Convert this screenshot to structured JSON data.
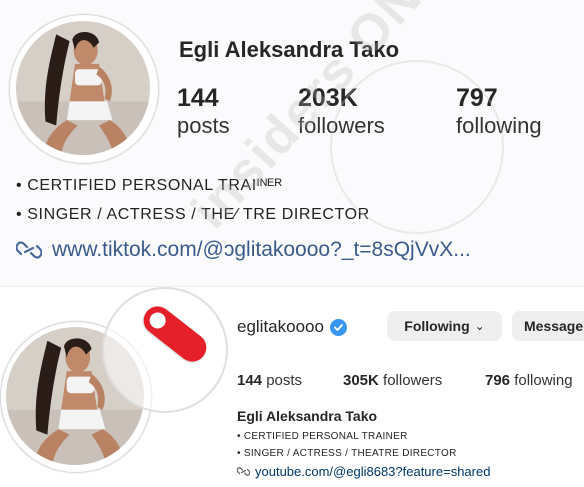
{
  "top_profile": {
    "name": "Egli Aleksandra Tako",
    "stats": [
      {
        "number": "144",
        "label": "posts"
      },
      {
        "number": "203K",
        "label": "followers"
      },
      {
        "number": "797",
        "label": "following"
      }
    ],
    "bio": [
      "• CERTIFIED PERSONAL TRAIᴵᴺᴱᴿ",
      "• SINGER / ACTRESS / THE∕ TRE DIRECTOR"
    ],
    "link": "www.tiktok.com/@ɔglitakoooo?_t=8sQjVvX..."
  },
  "bottom_profile": {
    "username": "eglitakoooo",
    "following_button": "Following",
    "message_button": "Message",
    "stats": [
      {
        "number": "144",
        "label": "posts"
      },
      {
        "number": "305K",
        "label": "followers"
      },
      {
        "number": "796",
        "label": "following"
      }
    ],
    "name": "Egli Aleksandra Tako",
    "bio": [
      "• CERTIFIED PERSONAL TRAINER",
      "• SINGER / ACTRESS / THEATRE DIRECTOR"
    ],
    "link": "youtube.com/@egli8683?feature=shared"
  },
  "watermark": "insiders ONLINE",
  "colors": {
    "verified": "#3897f0",
    "marker": "#e6202b",
    "link_top": "#3a5a8c",
    "link_bottom": "#00376b"
  },
  "icons": [
    "link-icon",
    "verified-badge-icon",
    "chevron-down-icon",
    "red-marker-icon"
  ]
}
